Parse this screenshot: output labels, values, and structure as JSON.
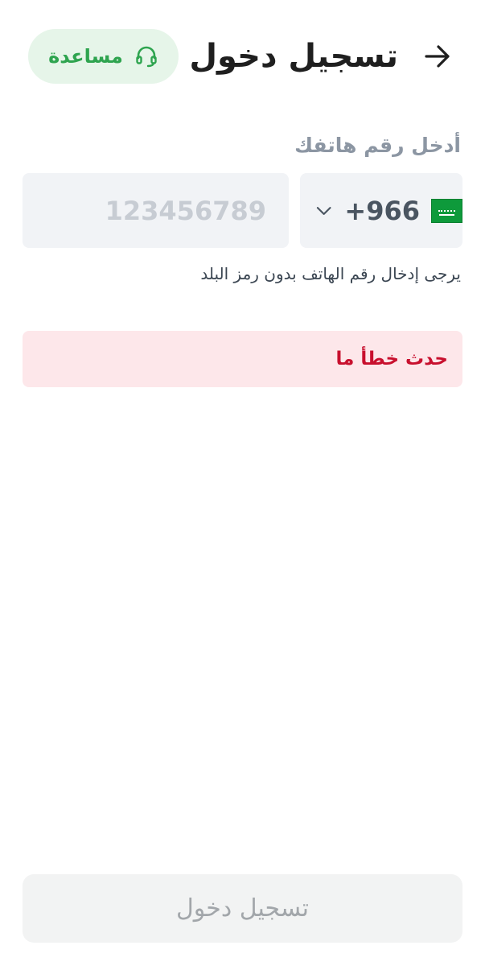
{
  "header": {
    "title": "تسجيل دخول",
    "help_label": "مساعدة",
    "back_icon": "arrow-right-icon",
    "help_icon": "headset-icon"
  },
  "form": {
    "phone_label": "أدخل رقم هاتفك",
    "phone_placeholder": "123456789",
    "phone_value": "",
    "country_code": "+966",
    "country_flag_icon": "saudi-flag-icon",
    "dropdown_icon": "chevron-down-icon",
    "hint": "يرجى إدخال رقم الهاتف بدون رمز البلد"
  },
  "error": {
    "message": "حدث خطأ ما"
  },
  "footer": {
    "login_label": "تسجيل دخول"
  },
  "colors": {
    "accent_green": "#2ea44f",
    "help_bg": "#e6f5e9",
    "error_text": "#c8102e",
    "error_bg": "#fde7ea",
    "input_bg": "#f1f3f6",
    "disabled_button_bg": "#f2f3f3"
  }
}
